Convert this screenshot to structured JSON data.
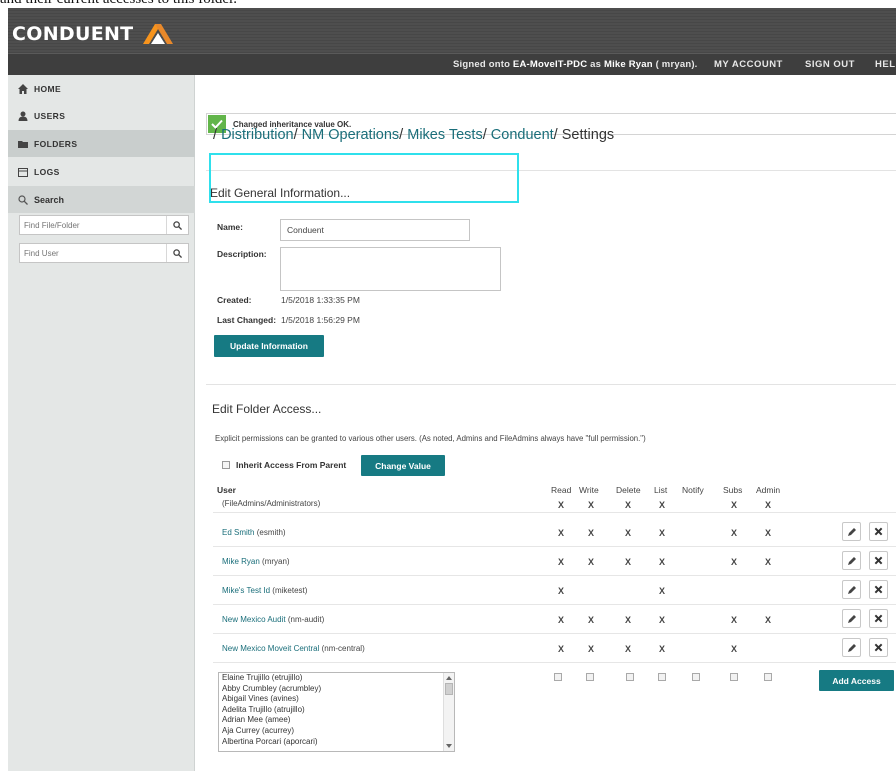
{
  "caption": "and their current accesses to this folder.",
  "brand": {
    "name": "CONDUENT",
    "logo_colors": [
      "#f7941d",
      "#e8892b",
      "#ffffff"
    ]
  },
  "header": {
    "signed_prefix": "Signed onto ",
    "server": "EA-MoveIT-PDC",
    "signed_mid": " as ",
    "user": "Mike Ryan",
    "signed_suffix": " ( mryan).",
    "links": [
      "MY ACCOUNT",
      "SIGN OUT",
      "HELP"
    ]
  },
  "sidebar": {
    "items": [
      {
        "label": "HOME",
        "icon": "home-icon"
      },
      {
        "label": "USERS",
        "icon": "user-icon"
      },
      {
        "label": "FOLDERS",
        "icon": "folder-icon"
      },
      {
        "label": "LOGS",
        "icon": "calendar-icon"
      }
    ],
    "search_label": "Search",
    "find_file_placeholder": "Find File/Folder",
    "find_user_placeholder": "Find User"
  },
  "notice": "Changed inheritance value OK.",
  "breadcrumb": {
    "parts": [
      "Distribution",
      "NM Operations",
      "Mikes Tests",
      "Conduent"
    ],
    "current": "Settings"
  },
  "general": {
    "title": "Edit General Information...",
    "name_label": "Name:",
    "name_value": "Conduent",
    "description_label": "Description:",
    "description_value": "",
    "created_label": "Created:",
    "created_value": "1/5/2018 1:33:35 PM",
    "changed_label": "Last Changed:",
    "changed_value": "1/5/2018 1:56:29 PM",
    "update_button": "Update Information"
  },
  "access": {
    "title": "Edit Folder Access...",
    "note": "Explicit permissions can be granted to various other users. (As noted, Admins and FileAdmins always have \"full permission.\")",
    "inherit_label": "Inherit Access From Parent",
    "change_button": "Change Value",
    "columns": [
      "User",
      "Read",
      "Write",
      "Delete",
      "List",
      "Notify",
      "Subs",
      "Admin"
    ],
    "mark": "X",
    "rows": [
      {
        "name": "",
        "id": "(FileAdmins/Administrators)",
        "perms": [
          1,
          1,
          1,
          1,
          0,
          1,
          1
        ],
        "actions": false
      },
      {
        "name": "Ed Smith",
        "id": "(esmith)",
        "perms": [
          1,
          1,
          1,
          1,
          0,
          1,
          1
        ],
        "actions": true
      },
      {
        "name": "Mike Ryan",
        "id": "(mryan)",
        "perms": [
          1,
          1,
          1,
          1,
          0,
          1,
          1
        ],
        "actions": true
      },
      {
        "name": "Mike's Test Id",
        "id": "(miketest)",
        "perms": [
          1,
          0,
          0,
          1,
          0,
          0,
          0
        ],
        "actions": true
      },
      {
        "name": "New Mexico Audit",
        "id": " (nm-audit)",
        "perms": [
          1,
          1,
          1,
          1,
          0,
          1,
          1
        ],
        "actions": true
      },
      {
        "name": "New Mexico Moveit Central",
        "id": "(nm-central)",
        "perms": [
          1,
          1,
          1,
          1,
          0,
          1,
          0
        ],
        "actions": true
      }
    ],
    "user_list": [
      "Elaine Trujillo  (etrujillo)",
      "Abby Crumbley  (acrumbley)",
      "Abigail Vines (avines)",
      "Adelita Trujillo (atrujillo)",
      "Adrian Mee (amee)",
      "Aja Currey (acurrey)",
      "Albertina Porcari (aporcari)"
    ],
    "add_button": "Add Access"
  }
}
